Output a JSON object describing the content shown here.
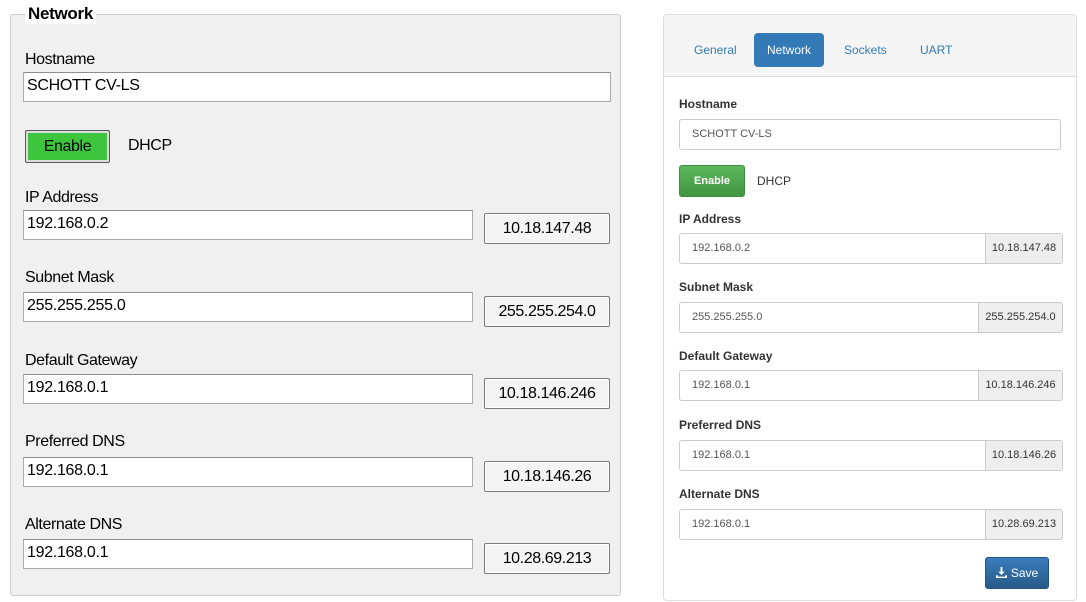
{
  "legacy": {
    "group_title": "Network",
    "hostname_label": "Hostname",
    "hostname_value": "SCHOTT CV-LS",
    "enable_label": "Enable",
    "dhcp_label": "DHCP",
    "fields": [
      {
        "label": "IP Address",
        "value": "192.168.0.2",
        "current": "10.18.147.48"
      },
      {
        "label": "Subnet Mask",
        "value": "255.255.255.0",
        "current": "255.255.254.0"
      },
      {
        "label": "Default Gateway",
        "value": "192.168.0.1",
        "current": "10.18.146.246"
      },
      {
        "label": "Preferred DNS",
        "value": "192.168.0.1",
        "current": "10.18.146.26"
      },
      {
        "label": "Alternate DNS",
        "value": "192.168.0.1",
        "current": "10.28.69.213"
      }
    ]
  },
  "web": {
    "tabs": [
      "General",
      "Network",
      "Sockets",
      "UART"
    ],
    "active_tab": "Network",
    "hostname_label": "Hostname",
    "hostname_value": "SCHOTT CV-LS",
    "enable_label": "Enable",
    "dhcp_label": "DHCP",
    "fields": [
      {
        "label": "IP Address",
        "value": "192.168.0.2",
        "current": "10.18.147.48"
      },
      {
        "label": "Subnet Mask",
        "value": "255.255.255.0",
        "current": "255.255.254.0"
      },
      {
        "label": "Default Gateway",
        "value": "192.168.0.1",
        "current": "10.18.146.246"
      },
      {
        "label": "Preferred DNS",
        "value": "192.168.0.1",
        "current": "10.18.146.26"
      },
      {
        "label": "Alternate DNS",
        "value": "192.168.0.1",
        "current": "10.28.69.213"
      }
    ],
    "save_label": "Save",
    "save_icon": "download-icon"
  },
  "colors": {
    "legacy_enable": "#3ec53e",
    "web_primary": "#337ab7",
    "web_success": "#5cb85c"
  }
}
